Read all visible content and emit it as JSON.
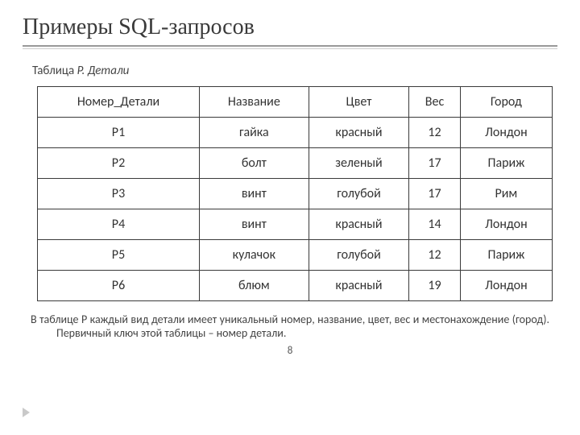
{
  "title": "Примеры SQL-запросов",
  "caption_prefix": "Таблица ",
  "caption_name": "P. Детали",
  "headers": [
    "Номер_Детали",
    "Название",
    "Цвет",
    "Вес",
    "Город"
  ],
  "rows": [
    [
      "P1",
      "гайка",
      "красный",
      "12",
      "Лондон"
    ],
    [
      "P2",
      "болт",
      "зеленый",
      "17",
      "Париж"
    ],
    [
      "P3",
      "винт",
      "голубой",
      "17",
      "Рим"
    ],
    [
      "P4",
      "винт",
      "красный",
      "14",
      "Лондон"
    ],
    [
      "P5",
      "кулачок",
      "голубой",
      "12",
      "Париж"
    ],
    [
      "P6",
      "блюм",
      "красный",
      "19",
      "Лондон"
    ]
  ],
  "footnote": "В таблице P каждый вид детали имеет  уникальный номер, название, цвет, вес и местонахождение (город). Первичный ключ этой таблицы – номер детали.",
  "slide_number": "8"
}
